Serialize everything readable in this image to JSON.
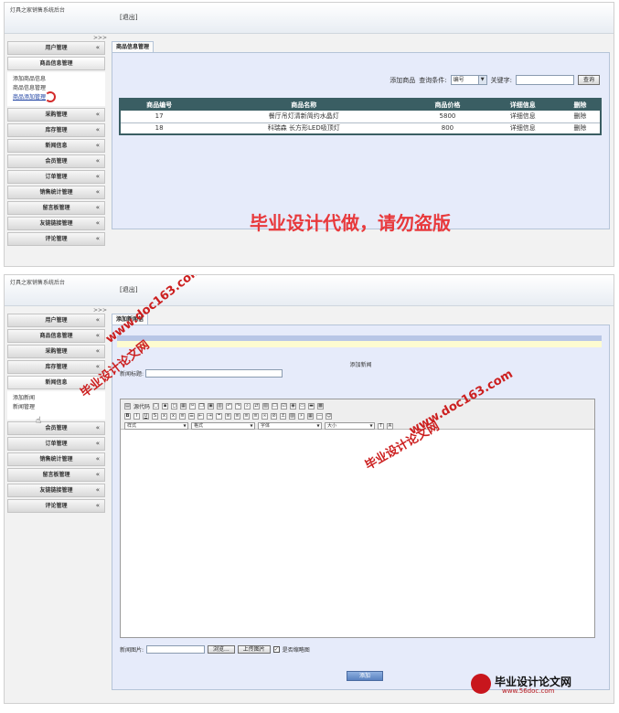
{
  "panel1": {
    "system_title": "灯具之家销售系统后台",
    "logout": "[退出]",
    "collapse": ">>>",
    "menu": [
      {
        "label": "用户管理",
        "chevron": "«"
      },
      {
        "label": "商品信息管理",
        "chevron": ""
      },
      {
        "label": "采购管理",
        "chevron": "«"
      },
      {
        "label": "库存管理",
        "chevron": "«"
      },
      {
        "label": "新闻信息",
        "chevron": "«"
      },
      {
        "label": "会员管理",
        "chevron": "«"
      },
      {
        "label": "订单管理",
        "chevron": "«"
      },
      {
        "label": "销售统计管理",
        "chevron": "«"
      },
      {
        "label": "留言板管理",
        "chevron": "«"
      },
      {
        "label": "友链链接管理",
        "chevron": "«"
      },
      {
        "label": "评论管理",
        "chevron": "«"
      }
    ],
    "submenu": [
      "添加商品信息",
      "商品信息管理",
      "商品添加管理"
    ],
    "tab": "商品信息管理",
    "search": {
      "add_link": "添加商品",
      "condition_label": "查询条件:",
      "select_value": "编号",
      "keyword_label": "关键字:",
      "button": "查询"
    },
    "table": {
      "headers": [
        "商品编号",
        "商品名称",
        "商品价格",
        "详细信息",
        "删除"
      ],
      "rows": [
        [
          "17",
          "餐厅吊灯清新简约水晶灯",
          "5800",
          "详细信息",
          "删除"
        ],
        [
          "18",
          "科瑞森 长方形LED吸顶灯",
          "800",
          "详细信息",
          "删除"
        ]
      ]
    },
    "watermark": "毕业设计代做，请勿盗版"
  },
  "panel2": {
    "system_title": "灯具之家销售系统后台",
    "logout": "[退出]",
    "collapse": ">>>",
    "menu_top": [
      {
        "label": "用户管理",
        "chevron": "«"
      },
      {
        "label": "商品信息管理",
        "chevron": "«"
      },
      {
        "label": "采购管理",
        "chevron": "«"
      },
      {
        "label": "库存管理",
        "chevron": "«"
      },
      {
        "label": "新闻信息",
        "chevron": ""
      }
    ],
    "submenu": [
      "添加新闻",
      "新闻管理"
    ],
    "menu_bottom": [
      {
        "label": "会员管理",
        "chevron": "«"
      },
      {
        "label": "订单管理",
        "chevron": "«"
      },
      {
        "label": "销售统计管理",
        "chevron": "«"
      },
      {
        "label": "留言板管理",
        "chevron": "«"
      },
      {
        "label": "友链链接管理",
        "chevron": "«"
      },
      {
        "label": "评论管理",
        "chevron": "«"
      }
    ],
    "tab": "添加新闻信",
    "form_title": "添加新闻",
    "news_title_label": "新闻标题:",
    "editor": {
      "source_label": "源代码",
      "style_label": "样式",
      "format_label": "格式",
      "font_label": "字体",
      "size_label": "大小"
    },
    "image_label": "新闻图片:",
    "browse_button": "浏览...",
    "upload_button": "上传图片",
    "thumb_label": "是否缩略图",
    "thumb_checked": true,
    "submit_button": "添加",
    "watermark_site": "www.doc163.com",
    "watermark_name": "毕业设计论文网",
    "logo_text": "毕业设计论文网",
    "logo_url": "www.56doc.com"
  }
}
